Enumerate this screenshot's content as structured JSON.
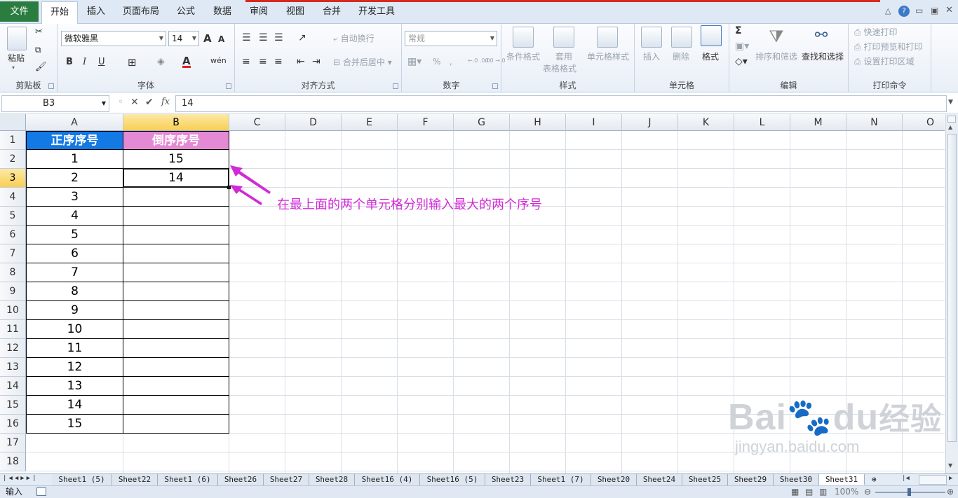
{
  "ribbon_tabs": [
    "文件",
    "开始",
    "插入",
    "页面布局",
    "公式",
    "数据",
    "审阅",
    "视图",
    "合并",
    "开发工具"
  ],
  "font_group": {
    "font_name": "微软雅黑",
    "font_size": "14",
    "label": "字体",
    "bold": "B",
    "italic": "I",
    "underline": "U",
    "font_color_glyph": "A",
    "grow": "A",
    "shrink": "A",
    "wen": "wén"
  },
  "clipboard": {
    "paste": "粘贴",
    "label": "剪贴板"
  },
  "alignment": {
    "wrap": "自动换行",
    "merge": "合并后居中",
    "label": "对齐方式"
  },
  "number": {
    "format": "常规",
    "percent": "%",
    "comma": ",",
    "inc": "←.0 .00",
    "dec": ".00 →.0",
    "label": "数字"
  },
  "styles": {
    "cond": "条件格式",
    "table_l1": "套用",
    "table_l2": "表格格式",
    "cell_style": "单元格样式",
    "label": "样式"
  },
  "cells": {
    "insert": "插入",
    "delete": "删除",
    "format": "格式",
    "label": "单元格"
  },
  "editing": {
    "sum": "Σ",
    "sort": "排序和筛选",
    "find": "查找和选择",
    "label": "编辑"
  },
  "print": {
    "quick": "快速打印",
    "preview": "打印预览和打印",
    "area": "设置打印区域",
    "label": "打印命令"
  },
  "formula_bar": {
    "name_box": "B3",
    "fx": "fx",
    "value": "14"
  },
  "columns": [
    "A",
    "B",
    "C",
    "D",
    "E",
    "F",
    "G",
    "H",
    "I",
    "J",
    "K",
    "L",
    "M",
    "N",
    "O"
  ],
  "rows": [
    "1",
    "2",
    "3",
    "4",
    "5",
    "6",
    "7",
    "8",
    "9",
    "10",
    "11",
    "12",
    "13",
    "14",
    "15",
    "16",
    "17",
    "18"
  ],
  "table": {
    "header_a": "正序序号",
    "header_b": "倒序序号",
    "col_a": [
      "1",
      "2",
      "3",
      "4",
      "5",
      "6",
      "7",
      "8",
      "9",
      "10",
      "11",
      "12",
      "13",
      "14",
      "15"
    ],
    "col_b": [
      "15",
      "14"
    ]
  },
  "annotation": "在最上面的两个单元格分别输入最大的两个序号",
  "sheets": [
    "Sheet1 (5)",
    "Sheet22",
    "Sheet1 (6)",
    "Sheet26",
    "Sheet27",
    "Sheet28",
    "Sheet16 (4)",
    "Sheet16 (5)",
    "Sheet23",
    "Sheet1 (7)",
    "Sheet20",
    "Sheet24",
    "Sheet25",
    "Sheet29",
    "Sheet30",
    "Sheet31"
  ],
  "active_sheet": "Sheet31",
  "status": {
    "mode": "输入",
    "zoom": "100%"
  },
  "watermark": {
    "brand": "Bai",
    "brand2": "du",
    "cn": "经验",
    "url": "jingyan.baidu.com"
  },
  "colors": {
    "header_a_bg": "#1279e5",
    "header_b_bg": "#e48ad4",
    "annotation": "#d12ad6",
    "file_tab": "#2a7d3f"
  }
}
